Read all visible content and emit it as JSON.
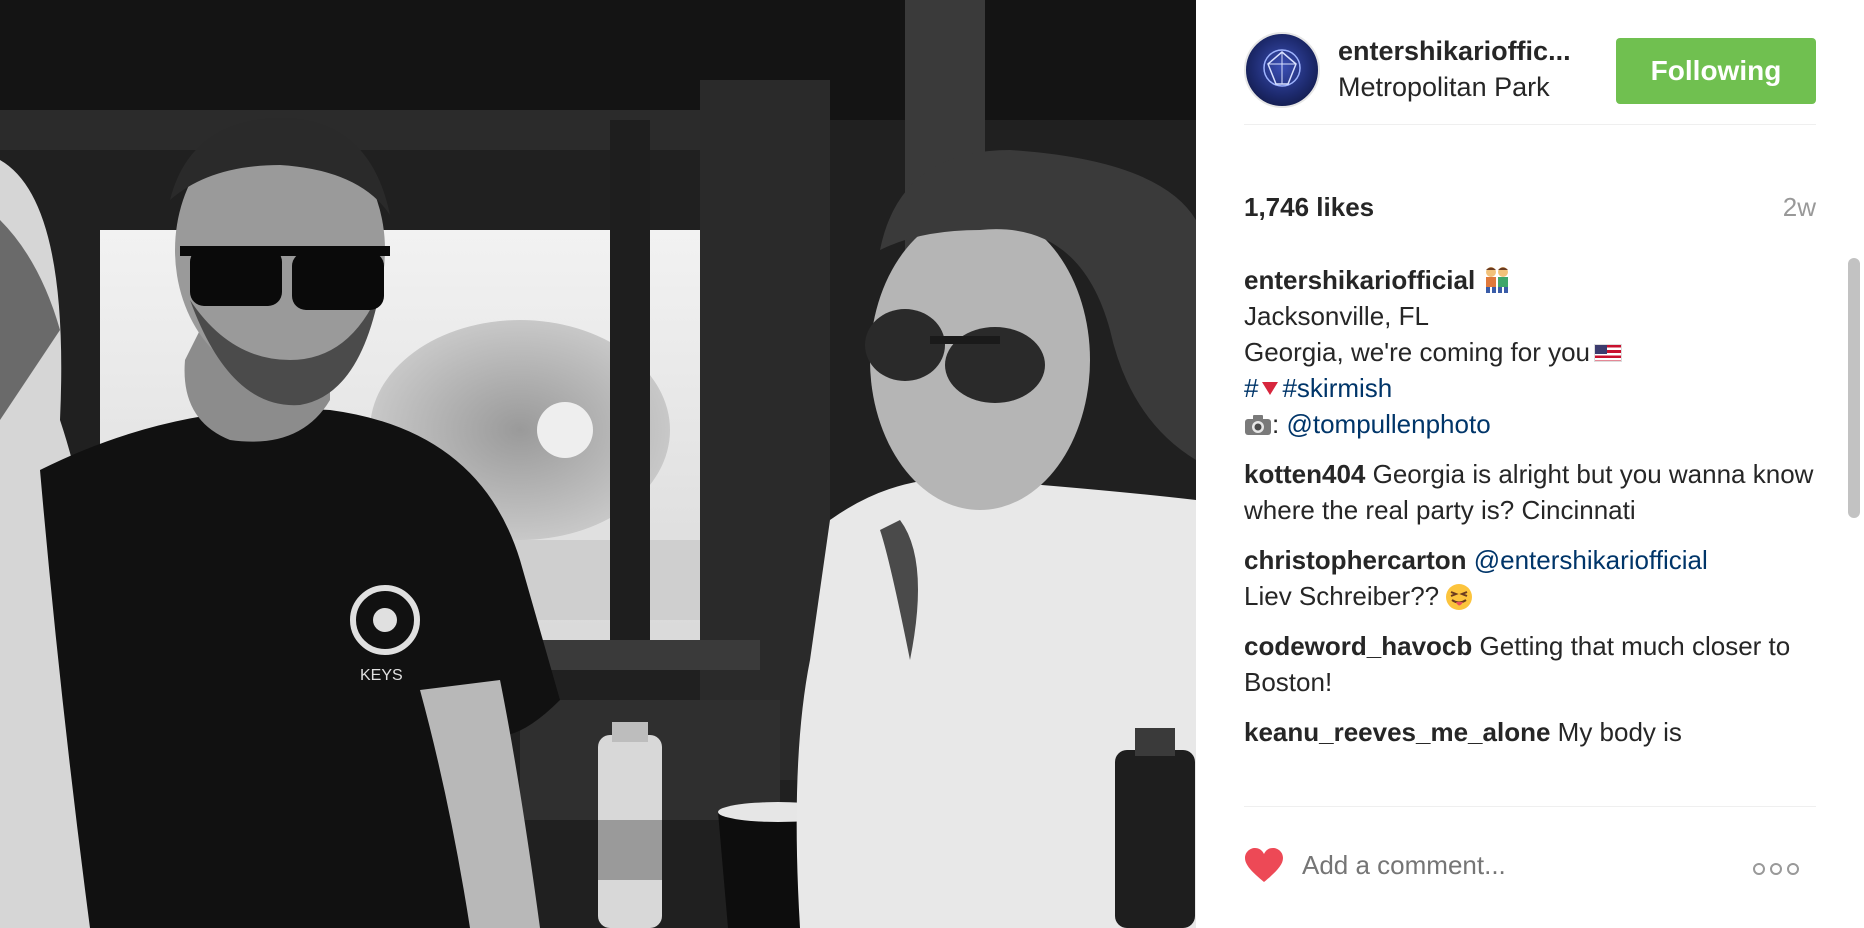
{
  "post": {
    "author": "entershikarioffic...",
    "location": "Metropolitan Park",
    "follow_label": "Following",
    "likes": "1,746 likes",
    "time_ago": "2w",
    "comment_placeholder": "Add a comment...",
    "more_options": "ooo"
  },
  "caption": {
    "user": "entershikariofficial",
    "line1": "Jacksonville, FL",
    "line2": "Georgia, we're coming for you",
    "hash_prefix": "#",
    "hashtag": "#skirmish",
    "photo_credit_sep": ":",
    "photo_credit": "@tompullenphoto"
  },
  "comments": [
    {
      "user": "kotten404",
      "text": "Georgia is alright but you wanna know where the real party is? Cincinnati"
    },
    {
      "user": "christophercarton",
      "mention": "@entershikariofficial",
      "text": "Liev Schreiber??"
    },
    {
      "user": "codeword_havocb",
      "text": "Getting that much closer to Boston!"
    },
    {
      "user": "keanu_reeves_me_alone",
      "text": "My body is"
    }
  ],
  "colors": {
    "follow_button": "#70c050",
    "link": "#003569",
    "heart": "#ed4956",
    "muted": "#999999"
  },
  "icons": {
    "heart": "heart-icon",
    "more": "more-options-icon",
    "camera": "camera-icon",
    "flag": "us-flag-icon"
  }
}
